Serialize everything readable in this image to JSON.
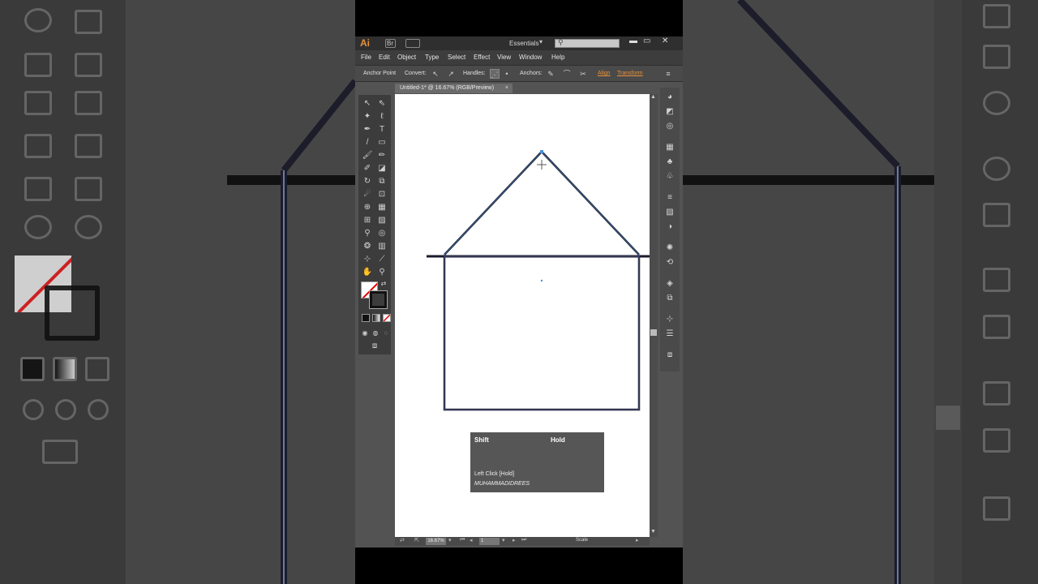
{
  "app": {
    "logo": "Ai",
    "bridge_label": "Br",
    "workspace": "Essentials",
    "search_placeholder": "",
    "menu": [
      "File",
      "Edit",
      "Object",
      "Type",
      "Select",
      "Effect",
      "View",
      "Window",
      "Help"
    ]
  },
  "control_bar": {
    "mode_label": "Anchor Point",
    "convert_label": "Convert:",
    "handles_label": "Handles:",
    "anchors_label": "Anchors:",
    "align_link": "Align",
    "transform_link": "Transform"
  },
  "document": {
    "tab_title": "Untitled-1* @ 16.67% (RGB/Preview)",
    "tab_close": "×"
  },
  "status_bar": {
    "zoom": "16.67%",
    "page": "1",
    "tool_status": "Scale"
  },
  "overlay": {
    "key_modifier": "Shift",
    "key_action_state": "Hold",
    "mouse_action": "Left Click [Hold]",
    "author": "MUHAMMADIDREES"
  },
  "colors": {
    "accent_orange": "#e8913a",
    "house_stroke": "#1b1b2a",
    "selection_blue": "#4a90d9",
    "no_fill_red": "#dd0000"
  },
  "icons": {
    "tools": [
      "selection-icon",
      "direct-selection-icon",
      "magic-wand-icon",
      "lasso-icon",
      "pen-icon",
      "type-icon",
      "line-icon",
      "rectangle-icon",
      "paintbrush-icon",
      "pencil-icon",
      "blob-brush-icon",
      "eraser-icon",
      "rotate-icon",
      "scale-icon",
      "warp-icon",
      "free-transform-icon",
      "shape-builder-icon",
      "perspective-icon",
      "mesh-icon",
      "gradient-icon",
      "eyedropper-icon",
      "blend-icon",
      "symbol-sprayer-icon",
      "column-graph-icon",
      "artboard-icon",
      "slice-icon",
      "hand-icon",
      "zoom-icon"
    ],
    "dock": [
      "color-icon",
      "color-guide-icon",
      "swatches-icon",
      "brushes-icon",
      "symbols-icon",
      "stroke-icon",
      "gradient-icon",
      "transparency-icon",
      "appearance-icon",
      "graphic-styles-icon",
      "layers-icon",
      "artboards-icon",
      "transform-icon",
      "align-icon",
      "pathfinder-icon"
    ]
  }
}
